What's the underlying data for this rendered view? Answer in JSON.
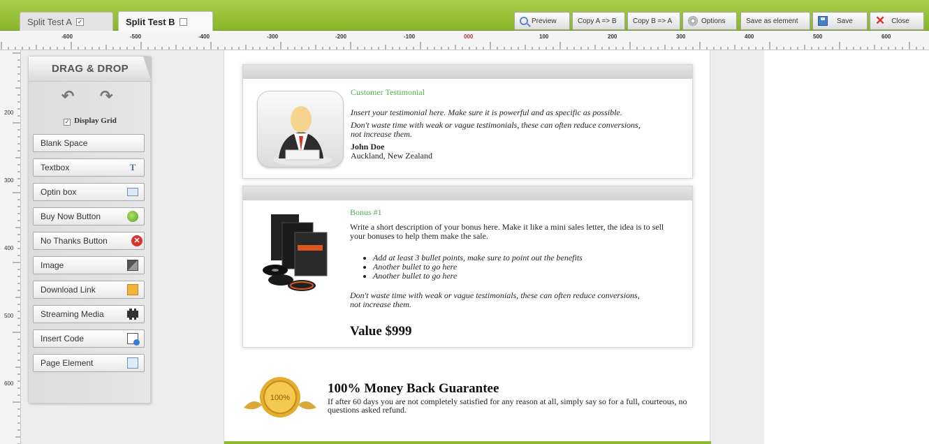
{
  "tabs": [
    {
      "label": "Split Test A",
      "checked": true
    },
    {
      "label": "Split Test B",
      "checked": false
    }
  ],
  "toolbar": {
    "preview": "Preview",
    "copy_a_b": "Copy A => B",
    "copy_b_a": "Copy B => A",
    "options": "Options",
    "save_as_element": "Save as element",
    "save": "Save",
    "close": "Close"
  },
  "ruler": {
    "h_labels": [
      "-600",
      "-500",
      "-400",
      "-300",
      "-200",
      "-100",
      "000",
      "100",
      "200",
      "300",
      "400",
      "500",
      "600"
    ],
    "v_labels": [
      "200",
      "300",
      "400",
      "500",
      "600"
    ]
  },
  "sidebar": {
    "title": "DRAG & DROP",
    "display_grid": "Display Grid",
    "items": [
      {
        "label": "Blank Space",
        "icon": ""
      },
      {
        "label": "Textbox",
        "icon": "text-icon"
      },
      {
        "label": "Optin box",
        "icon": "optin-icon"
      },
      {
        "label": "Buy Now Button",
        "icon": "green-button-icon"
      },
      {
        "label": "No Thanks Button",
        "icon": "red-x-icon"
      },
      {
        "label": "Image",
        "icon": "image-icon"
      },
      {
        "label": "Download Link",
        "icon": "download-icon"
      },
      {
        "label": "Streaming Media",
        "icon": "film-icon"
      },
      {
        "label": "Insert Code",
        "icon": "code-icon"
      },
      {
        "label": "Page Element",
        "icon": "page-element-icon"
      }
    ]
  },
  "testimonial": {
    "heading": "Customer Testimonial",
    "line1": "Insert your testimonial here. Make sure it is powerful and as specific as possible.",
    "line2": "Don't waste time with weak or vague testimonials, these can often reduce conversions, not increase them.",
    "name": "John Doe",
    "location": "Auckland, New Zealand"
  },
  "bonus": {
    "heading": "Bonus #1",
    "description": "Write a short description of your bonus here. Make it like a mini sales letter, the idea is to sell your bonuses to help them make the sale.",
    "bullets": [
      "Add at least 3 bullet points, make sure to point out the benefits",
      "Another bullet to go here",
      "Another bullet to go here"
    ],
    "note": "Don't waste time with weak or vague testimonials, these can often reduce conversions, not increase them.",
    "value": "Value $999"
  },
  "guarantee": {
    "title": "100% Money Back Guarantee",
    "text": "If after 60 days you are not completely satisfied for any reason at all, simply say so for a full, courteous, no questions asked refund.",
    "seal_text": "100%"
  },
  "colors": {
    "accent_green": "#8cba2e",
    "heading_green": "#4caf50",
    "close_red": "#d92d20"
  }
}
